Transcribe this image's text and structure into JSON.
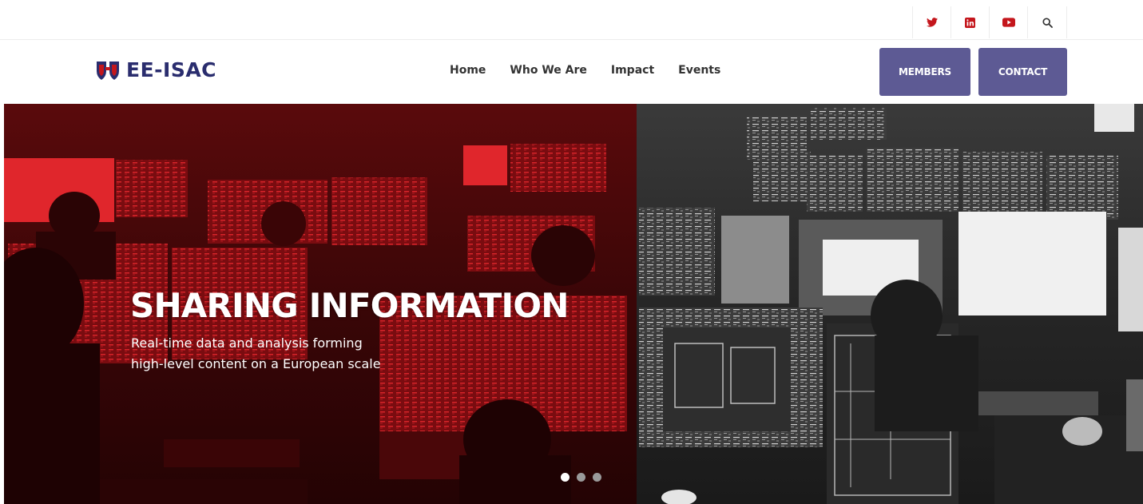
{
  "brand": {
    "name": "EE-ISAC",
    "primary_color": "#2a2d6e",
    "accent_color": "#c4161c",
    "button_color": "#5d5a94"
  },
  "topbar": {
    "icons": [
      {
        "name": "twitter-icon",
        "color": "#c4161c"
      },
      {
        "name": "linkedin-icon",
        "color": "#c4161c"
      },
      {
        "name": "youtube-icon",
        "color": "#c4161c"
      },
      {
        "name": "search-icon",
        "color": "#333333"
      }
    ]
  },
  "nav": {
    "items": [
      "Home",
      "Who We Are",
      "Impact",
      "Events"
    ]
  },
  "buttons": {
    "members": "MEMBERS",
    "contact": "CONTACT"
  },
  "hero": {
    "title": "SHARING INFORMATION",
    "subtitle_lines": [
      "Real-time data and analysis forming",
      "high-level content on a European scale"
    ],
    "slide_count": 3,
    "active_slide": 0
  }
}
